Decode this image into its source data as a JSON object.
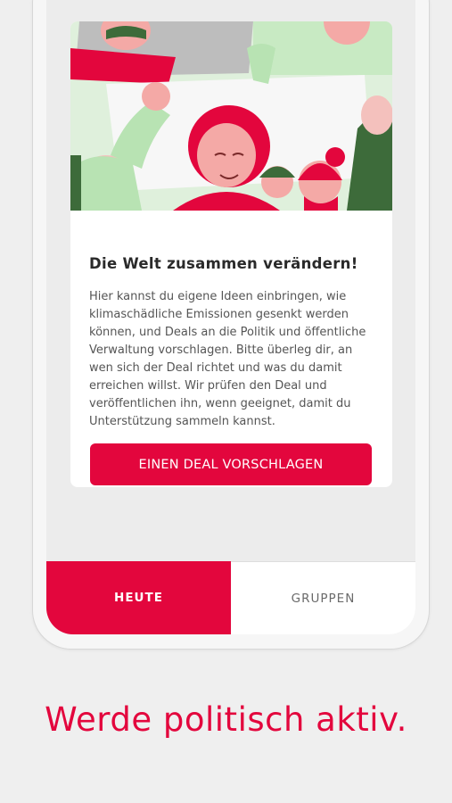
{
  "card": {
    "title": "Die Welt zusammen verändern!",
    "body": "Hier kannst du eigene Ideen einbringen, wie klimaschädliche Emissionen gesenkt werden können, und Deals an die Politik und öffentliche Verwaltung vorschlagen. Bitte überleg dir, an wen sich der Deal richtet und was du damit erreichen willst. Wir prüfen den Deal und veröffentlichen ihn, wenn geeignet, damit du Unterstützung sammeln kannst.",
    "cta_label": "EINEN DEAL VORSCHLAGEN"
  },
  "tabs": {
    "heute": "HEUTE",
    "gruppen": "GRUPPEN",
    "active": "HEUTE"
  },
  "tagline": "Werde politisch aktiv.",
  "colors": {
    "accent": "#e3063d",
    "background": "#efefef",
    "card": "#ffffff",
    "illustration_green": "#b8e3b3",
    "illustration_dark_green": "#3d6b3a",
    "illustration_pink": "#f4a9a6"
  },
  "illustration": {
    "name": "protest-crowd-illustration"
  }
}
